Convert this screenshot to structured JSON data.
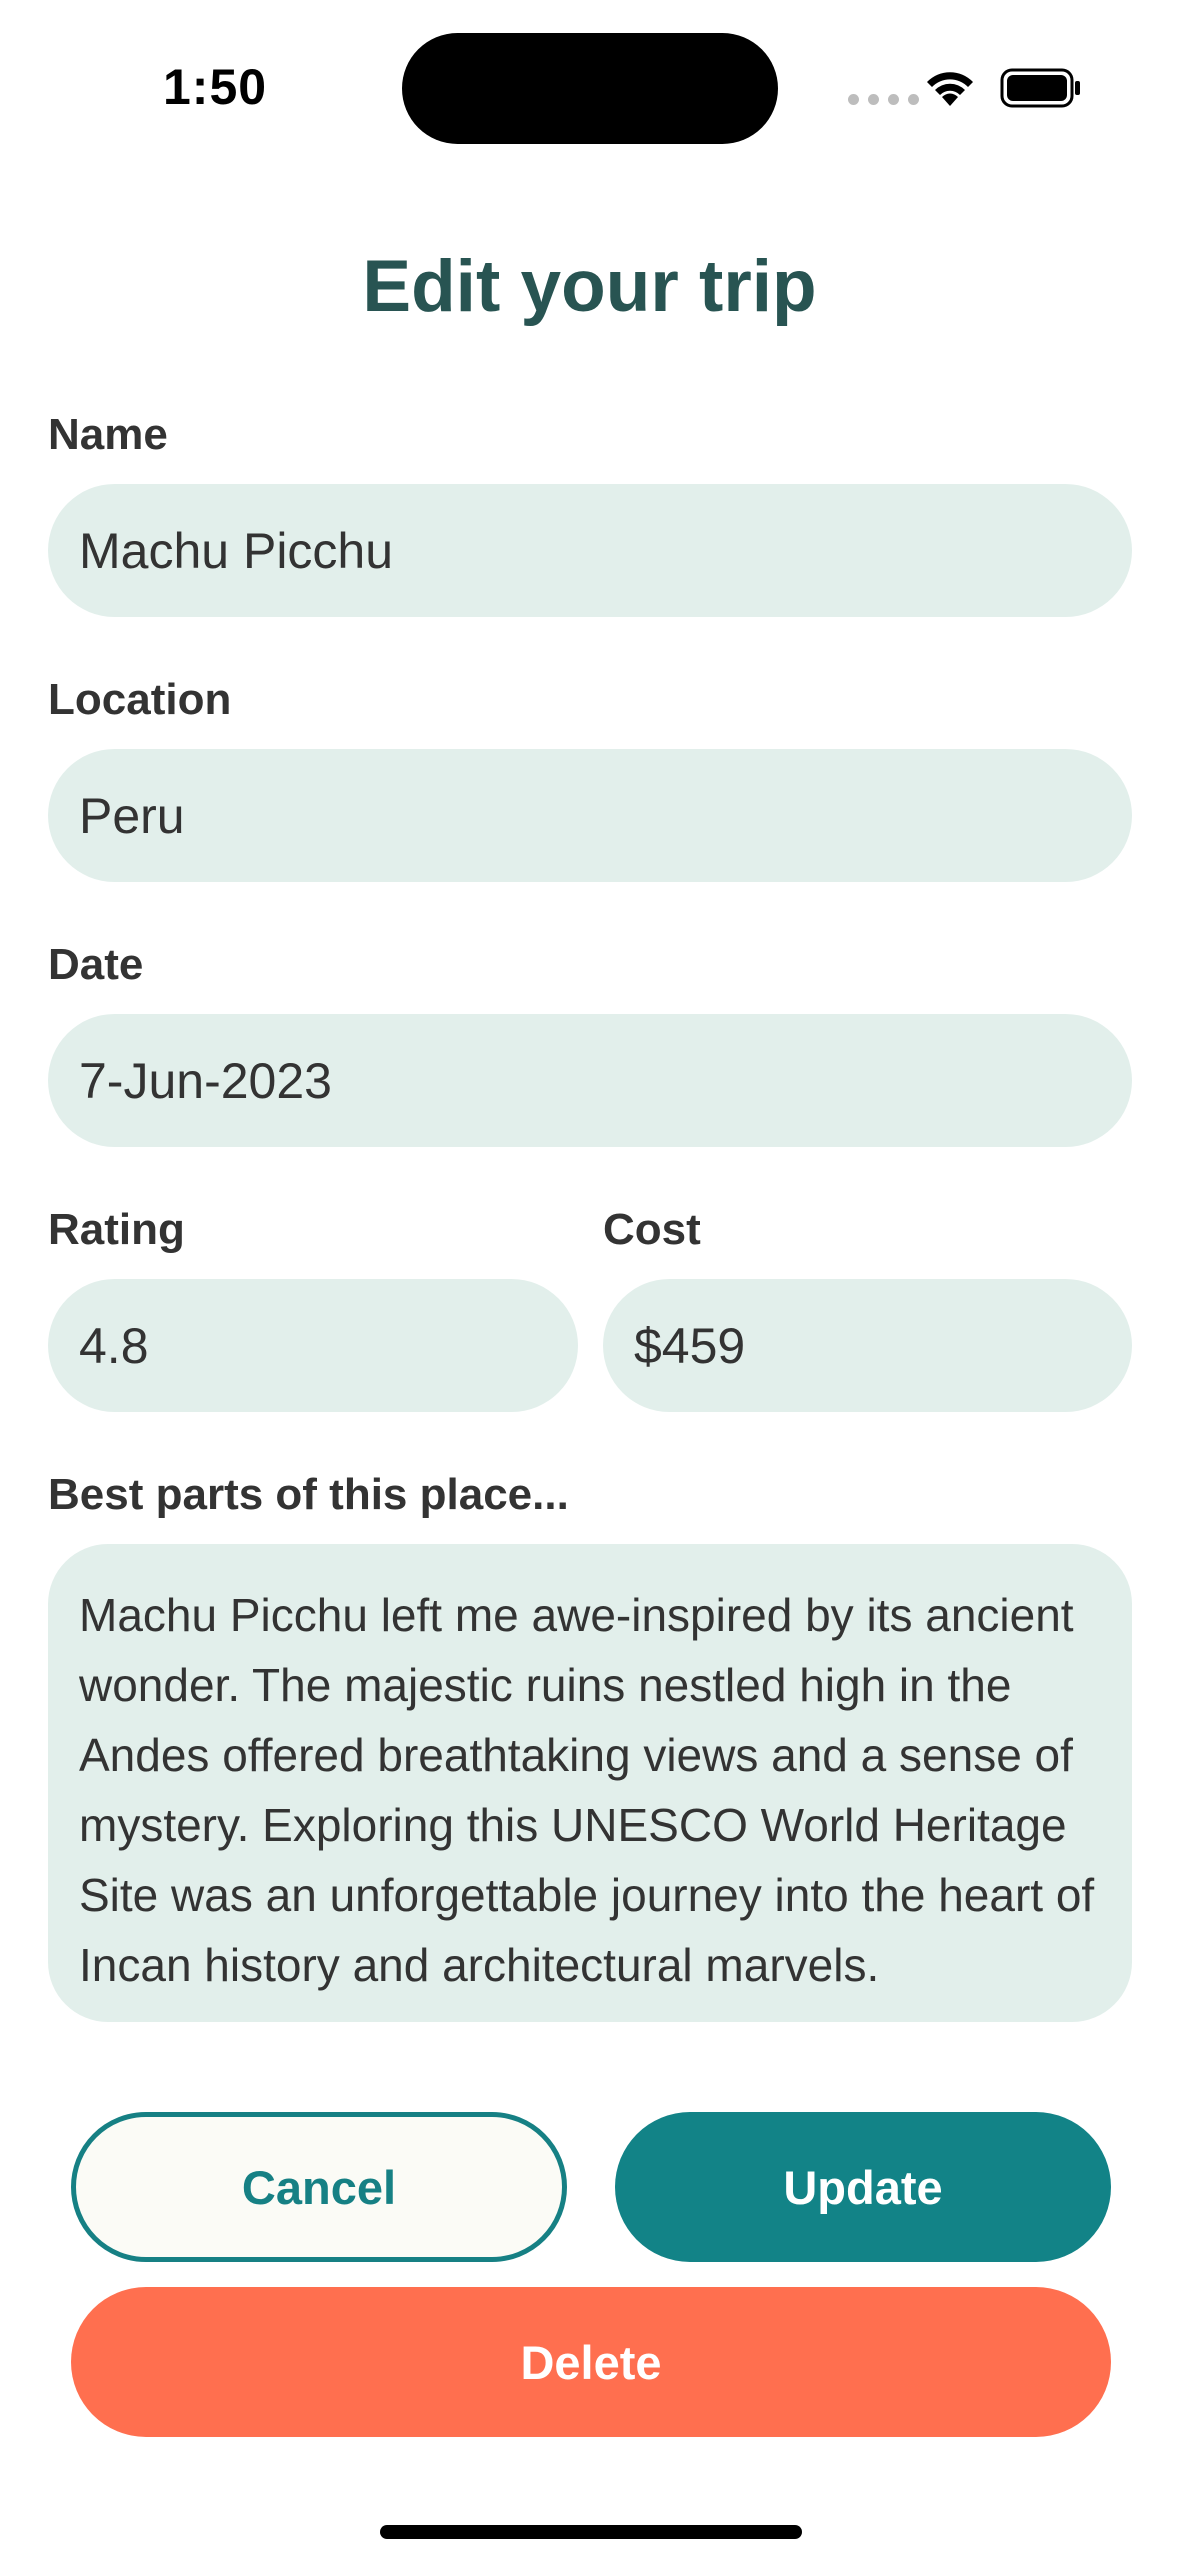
{
  "status_bar": {
    "time": "1:50"
  },
  "title": "Edit your trip",
  "form": {
    "name": {
      "label": "Name",
      "value": "Machu Picchu"
    },
    "location": {
      "label": "Location",
      "value": "Peru"
    },
    "date": {
      "label": "Date",
      "value": "7-Jun-2023"
    },
    "rating": {
      "label": "Rating",
      "value": "4.8"
    },
    "cost": {
      "label": "Cost",
      "value": "$459"
    },
    "best_parts": {
      "label": "Best parts of this place...",
      "value": "Machu Picchu left me awe-inspired by its ancient wonder. The majestic ruins nestled high in the Andes offered breathtaking views and a sense of mystery. Exploring this UNESCO World Heritage Site was an unforgettable journey into the heart of Incan history and architectural marvels."
    }
  },
  "buttons": {
    "cancel": "Cancel",
    "update": "Update",
    "delete": "Delete"
  },
  "colors": {
    "title": "#285452",
    "field_bg": "#e2efeb",
    "primary": "#128387",
    "danger": "#ff6f4f"
  },
  "icons": [
    "cellular-signal-icon",
    "wifi-icon",
    "battery-icon"
  ]
}
